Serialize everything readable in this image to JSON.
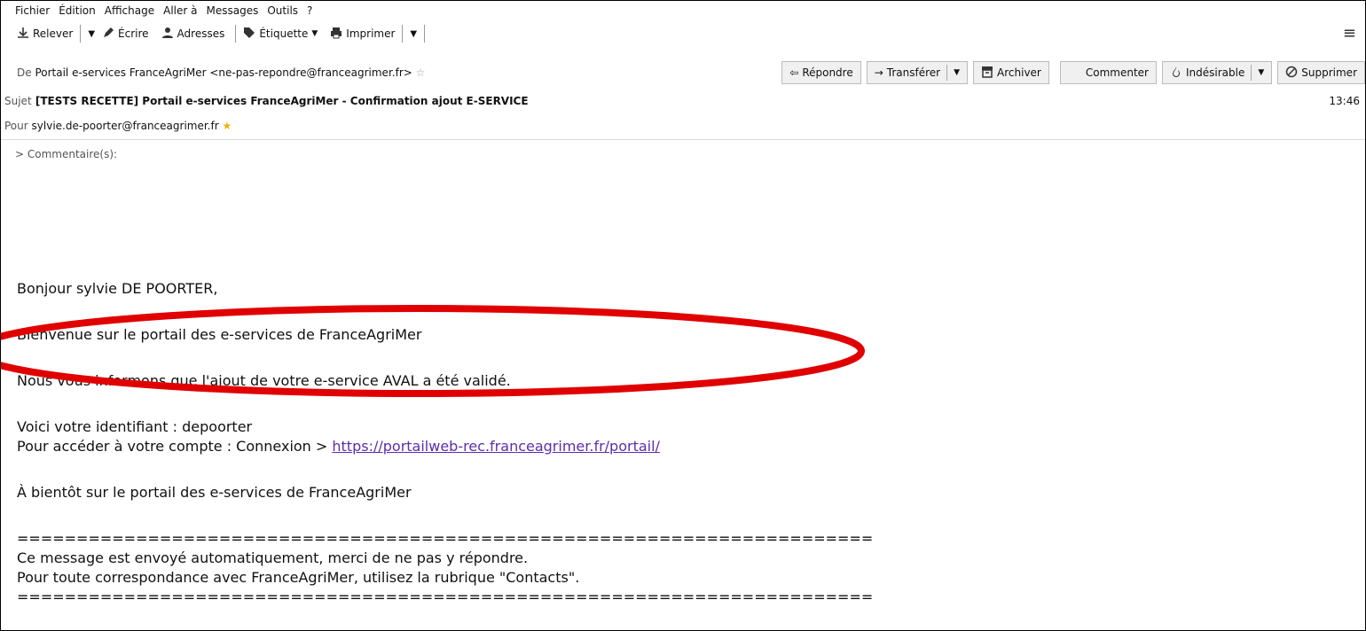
{
  "menu": {
    "items": [
      "Fichier",
      "Édition",
      "Affichage",
      "Aller à",
      "Messages",
      "Outils",
      "?"
    ]
  },
  "toolbar": {
    "releve_label": "Relever",
    "ecrire_label": "Écrire",
    "adresses_label": "Adresses",
    "etiquette_label": "Étiquette",
    "imprimer_label": "Imprimer"
  },
  "header": {
    "de_label": "De",
    "de_value": "Portail e-services FranceAgriMer <ne-pas-repondre@franceagrimer.fr>",
    "sujet_label": "Sujet",
    "sujet_value": "[TESTS RECETTE] Portail e-services FranceAgriMer - Confirmation ajout E-SERVICE",
    "time": "13:46",
    "pour_label": "Pour",
    "pour_value": "sylvie.de-poorter@franceagrimer.fr"
  },
  "actions": {
    "repondre": "Répondre",
    "transferer": "Transférer",
    "archiver": "Archiver",
    "commenter": "Commenter",
    "indesirable": "Indésirable",
    "supprimer": "Supprimer"
  },
  "comments": {
    "label": "Commentaire(s):"
  },
  "message": {
    "greeting": "Bonjour sylvie DE POORTER,",
    "welcome": "Bienvenue sur le portail des e-services de FranceAgriMer",
    "info": "Nous vous informons que l'ajout de votre e-service AVAL a été validé.",
    "identifiant": "Voici votre identifiant : depoorter",
    "access_prefix": "Pour accéder à votre compte : Connexion > ",
    "access_link": "https://portailweb-rec.franceagrimer.fr/portail/",
    "bientot": "À bientôt sur le portail des e-services de FranceAgriMer",
    "separator": "========================================================================",
    "auto": "Ce message est envoyé automatiquement, merci de ne pas y répondre.",
    "contact": "Pour toute correspondance avec FranceAgriMer, utilisez la rubrique \"Contacts\"."
  },
  "colors": {
    "link": "#5b2dad",
    "annotation": "#e00000"
  }
}
